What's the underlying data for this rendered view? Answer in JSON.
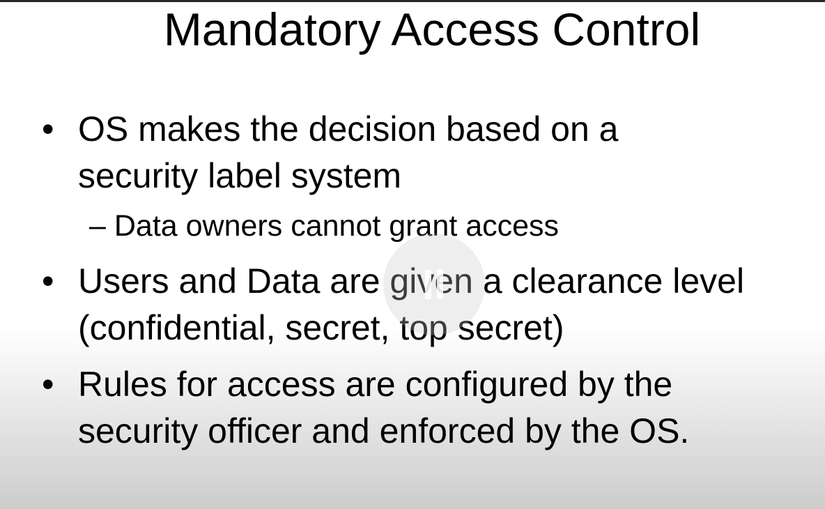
{
  "slide": {
    "title": "Mandatory Access Control",
    "bullet_glyph": "•",
    "bullets": [
      {
        "text": "OS makes the decision based on a security label system",
        "sub": "– Data owners cannot grant access"
      },
      {
        "text": "Users and Data are given a clearance level (confidential, secret, top secret)"
      },
      {
        "text": "Rules for access are configured by the security officer and enforced by the OS."
      }
    ]
  },
  "player": {
    "overlay_icon": "pause-icon"
  }
}
